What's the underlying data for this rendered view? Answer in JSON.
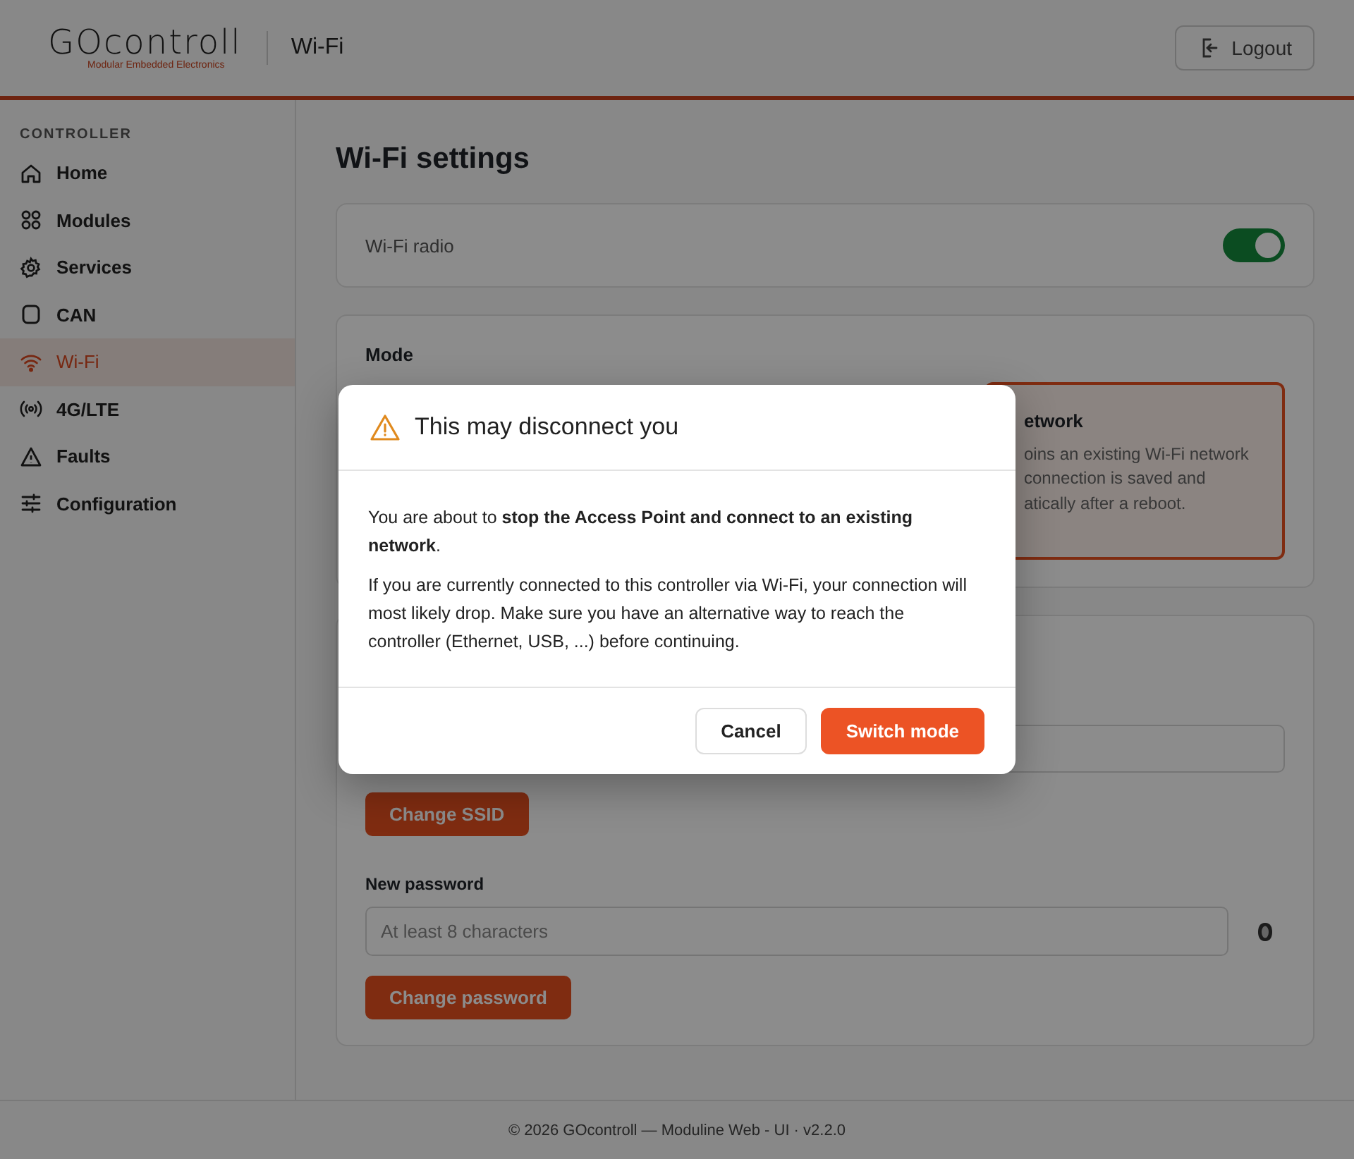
{
  "header": {
    "logo": {
      "name": "GOcontroll",
      "tagline": "Modular Embedded Electronics"
    },
    "page_title": "Wi-Fi",
    "logout_button": "Logout"
  },
  "sidebar": {
    "section": "CONTROLLER",
    "items": [
      {
        "label": "Home",
        "selected": false
      },
      {
        "label": "Modules",
        "selected": false
      },
      {
        "label": "Services",
        "selected": false
      },
      {
        "label": "CAN",
        "selected": false
      },
      {
        "label": "Wi-Fi",
        "selected": true
      },
      {
        "label": "4G/LTE",
        "selected": false
      },
      {
        "label": "Faults",
        "selected": false
      },
      {
        "label": "Configuration",
        "selected": false
      }
    ]
  },
  "main": {
    "title": "Wi-Fi settings",
    "radio": {
      "label": "Wi-Fi radio",
      "on": true
    },
    "mode": {
      "label": "Mode",
      "options": [
        {
          "title": "etwork",
          "description_lines": [
            "oins an existing Wi-Fi network",
            "connection is saved and",
            "atically after a reboot."
          ],
          "selected": true
        }
      ]
    },
    "ssid": {
      "change_button": "Change SSID"
    },
    "password": {
      "label": "New password",
      "placeholder": "At least 8 characters",
      "change_button": "Change password"
    }
  },
  "dialog": {
    "title": "This may disconnect you",
    "paragraphs": [
      "You are about to **stop the Access Point and connect to an existing network**.",
      "If you are currently connected to this controller via Wi-Fi, your connection will most likely drop. Make sure you have an alternative way to reach the controller (Ethernet, USB, ...) before continuing."
    ],
    "buttons": [
      {
        "label": "Cancel",
        "kind": "secondary"
      },
      {
        "label": "Switch mode",
        "kind": "primary"
      }
    ]
  },
  "footer": "© 2026 GOcontroll — Moduline Web - UI · v2.2.0"
}
